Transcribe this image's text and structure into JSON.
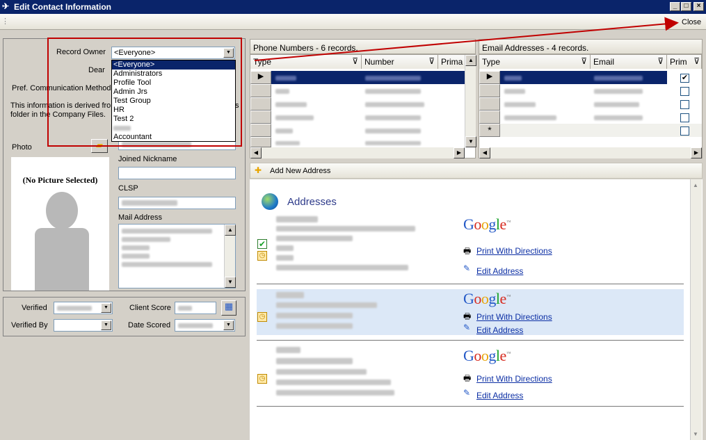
{
  "window": {
    "title": "Edit Contact Information",
    "min": "_",
    "max": "□",
    "close": "×"
  },
  "toolbar": {
    "close_label": "Close"
  },
  "left": {
    "record_owner_label": "Record Owner",
    "record_owner_value": "<Everyone>",
    "dear_label": "Dear",
    "pref_comm_label": "Pref. Communication Method",
    "info_text_1": "This information is derived from",
    "info_text_2": "folder in the Company Files.",
    "photo_label": "Photo",
    "no_picture": "(No Picture Selected)",
    "joined_nickname_label": "Joined Nickname",
    "clsp_label": "CLSP",
    "mail_address_label": "Mail Address",
    "verified_label": "Verified",
    "verified_by_label": "Verified By",
    "client_score_label": "Client Score",
    "date_scored_label": "Date Scored"
  },
  "owner_options": [
    "<Everyone>",
    "Administrators",
    "Profile Tool",
    "Admin Jrs",
    "Test Group",
    "HR",
    "Test 2",
    "",
    "",
    " Accountant"
  ],
  "phone": {
    "title": "Phone Numbers - 6 records.",
    "cols": [
      "Type",
      "Number",
      "Prima"
    ]
  },
  "email": {
    "title": "Email Addresses - 4 records.",
    "cols": [
      "Type",
      "Email",
      "Prim"
    ]
  },
  "addresses": {
    "add_label": "Add New Address",
    "heading": "Addresses",
    "print_label": "Print With Directions",
    "edit_label": "Edit Address",
    "google": [
      "G",
      "o",
      "o",
      "g",
      "l",
      "e"
    ],
    "tm": "™"
  },
  "colors": {
    "title_bar": "#0a246a",
    "highlight": "#dce8f7",
    "annotation": "#c00000"
  }
}
